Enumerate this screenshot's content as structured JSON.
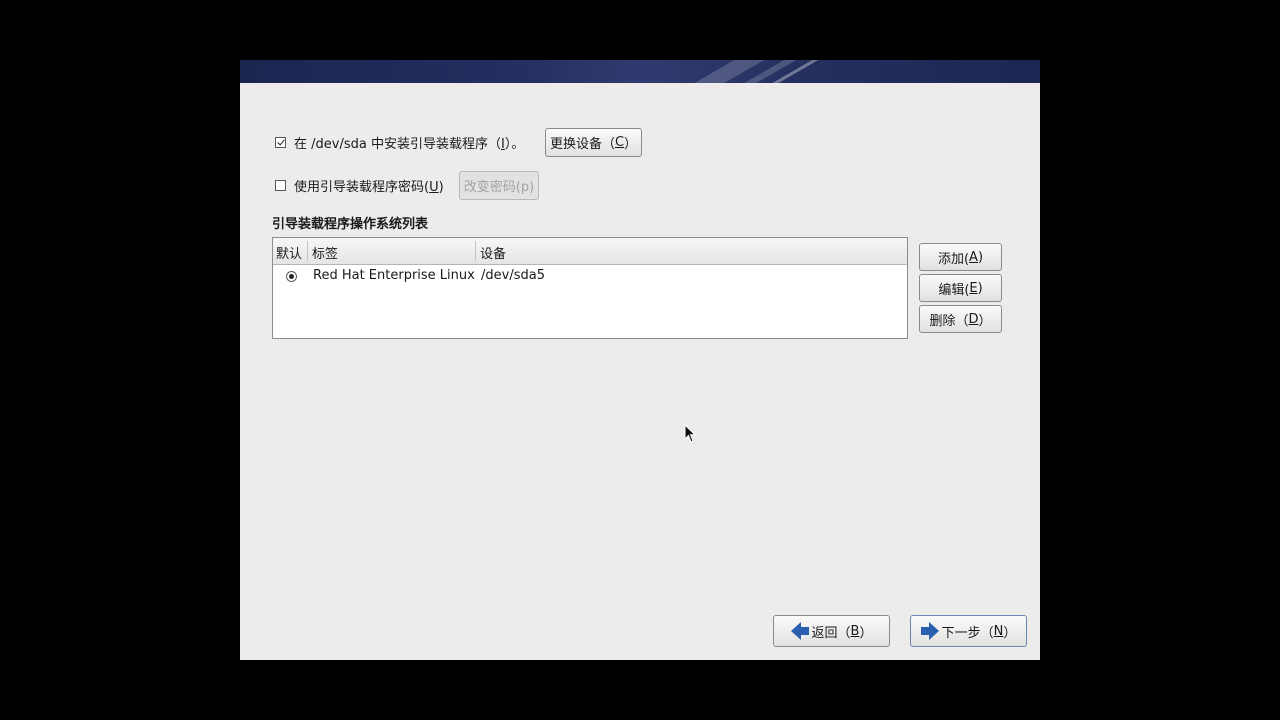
{
  "install": {
    "checked": true,
    "label": "在 /dev/sda 中安装引导装载程序（",
    "mnemonic": "I",
    "suffix": "）。",
    "change_device_button": "更换设备（",
    "change_device_mnemonic": "C",
    "change_device_suffix": "）"
  },
  "password": {
    "checked": false,
    "label": "使用引导装载程序密码(",
    "mnemonic": "U",
    "suffix": ")",
    "change_password_button": "改变密码(p)"
  },
  "os_list": {
    "title": "引导装载程序操作系统列表",
    "columns": [
      "默认",
      "标签",
      "设备"
    ],
    "rows": [
      {
        "default": true,
        "label": "Red Hat Enterprise Linux",
        "device": "/dev/sda5"
      }
    ]
  },
  "side_buttons": {
    "add": "添加(",
    "add_m": "A",
    "add_s": ")",
    "edit": "编辑(",
    "edit_m": "E",
    "edit_s": ")",
    "delete": "删除（",
    "delete_m": "D",
    "delete_s": "）"
  },
  "nav": {
    "back": "返回（",
    "back_m": "B",
    "back_s": "）",
    "next": "下一步（",
    "next_m": "N",
    "next_s": "）"
  },
  "colors": {
    "banner": "#1b2550",
    "window": "#edeceb",
    "arrow": "#2a5fb0"
  }
}
